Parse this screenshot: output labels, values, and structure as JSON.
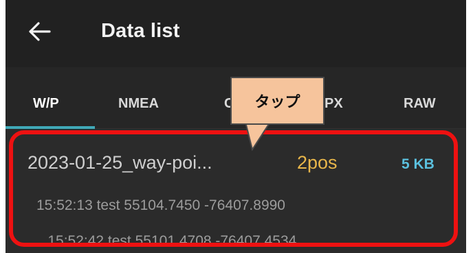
{
  "header": {
    "title": "Data list",
    "back_icon": "arrow-left-icon"
  },
  "tabs": [
    {
      "label": "W/P",
      "active": true
    },
    {
      "label": "NMEA",
      "active": false
    },
    {
      "label": "C",
      "active": false
    },
    {
      "label": "PX",
      "active": false
    },
    {
      "label": "RAW",
      "active": false
    }
  ],
  "file": {
    "name": "2023-01-25_way-poi...",
    "positions": "2pos",
    "size": "5 KB",
    "points": [
      "15:52:13 test 55104.7450 -76407.8990",
      "... 15:52:42 test 55101.4708 -76407.4534"
    ]
  },
  "annotation": {
    "callout_text": "タップ",
    "highlight_color": "#ee1111",
    "callout_color": "#f6c49c"
  },
  "colors": {
    "background": "#262626",
    "accent": "#3fa9b8",
    "position_count": "#e8b64a",
    "file_size": "#5bc0de"
  }
}
